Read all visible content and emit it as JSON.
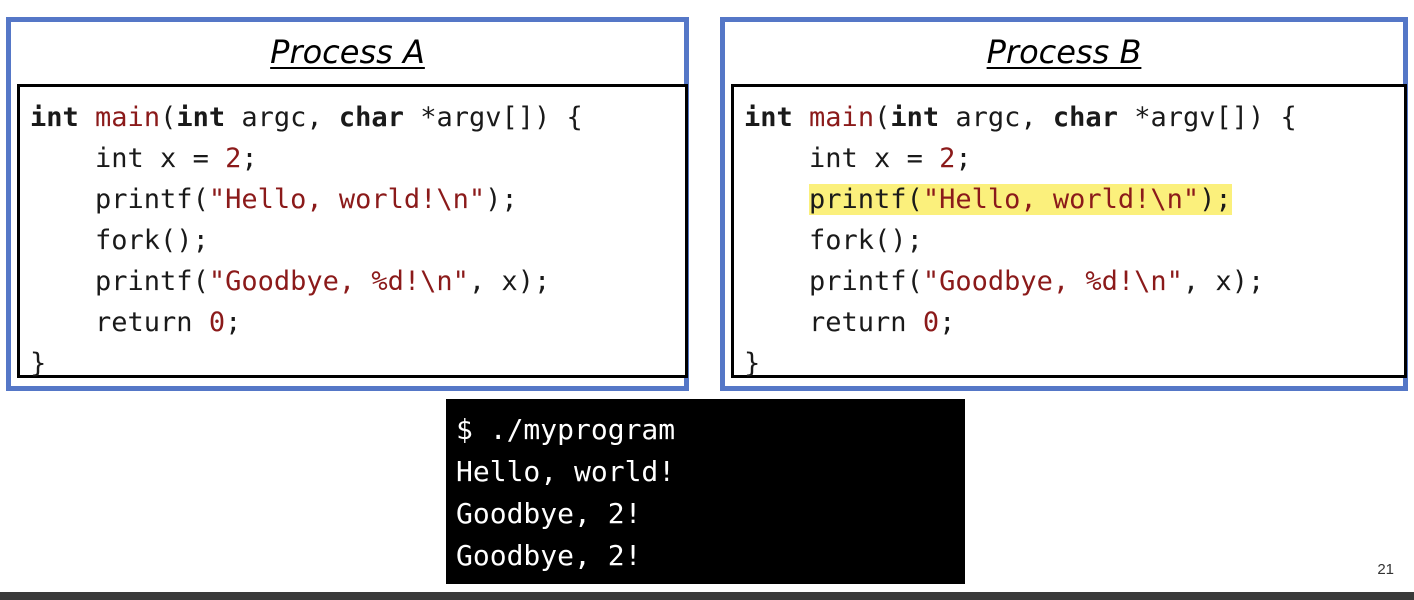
{
  "process_a": {
    "title": "Process A",
    "code": {
      "line1": {
        "kw_int": "int",
        "fn_main": "main",
        "open": "(",
        "kw_int2": "int",
        "argc": " argc, ",
        "kw_char": "char",
        "rest": " *argv[]) {"
      },
      "line2": {
        "indent": "    ",
        "text": "int x = ",
        "num": "2",
        "end": ";"
      },
      "line3": {
        "indent": "    ",
        "call": "printf(",
        "str": "\"Hello, world!\\n\"",
        "end": ");"
      },
      "line4": {
        "indent": "    ",
        "text": "fork();"
      },
      "line5": {
        "indent": "    ",
        "call": "printf(",
        "str": "\"Goodbye, %d!\\n\"",
        "end": ", x);"
      },
      "line6": {
        "indent": "    ",
        "text": "return ",
        "num": "0",
        "end": ";"
      },
      "line7": {
        "text": "}"
      }
    }
  },
  "process_b": {
    "title": "Process B",
    "highlighted_line": 3,
    "code": {
      "line1": {
        "kw_int": "int",
        "fn_main": "main",
        "open": "(",
        "kw_int2": "int",
        "argc": " argc, ",
        "kw_char": "char",
        "rest": " *argv[]) {"
      },
      "line2": {
        "indent": "    ",
        "text": "int x = ",
        "num": "2",
        "end": ";"
      },
      "line3": {
        "indent": "    ",
        "call": "printf(",
        "str": "\"Hello, world!\\n\"",
        "end": ");"
      },
      "line4": {
        "indent": "    ",
        "text": "fork();"
      },
      "line5": {
        "indent": "    ",
        "call": "printf(",
        "str": "\"Goodbye, %d!\\n\"",
        "end": ", x);"
      },
      "line6": {
        "indent": "    ",
        "text": "return ",
        "num": "0",
        "end": ";"
      },
      "line7": {
        "text": "}"
      }
    }
  },
  "terminal": {
    "lines": [
      "$ ./myprogram",
      "Hello, world!",
      "Goodbye, 2!",
      "Goodbye, 2!"
    ]
  },
  "slide_number": "21",
  "colors": {
    "box_border": "#5577c7",
    "code_accent": "#8b1a1a",
    "highlight": "#fbf07c",
    "terminal_bg": "#000000"
  }
}
